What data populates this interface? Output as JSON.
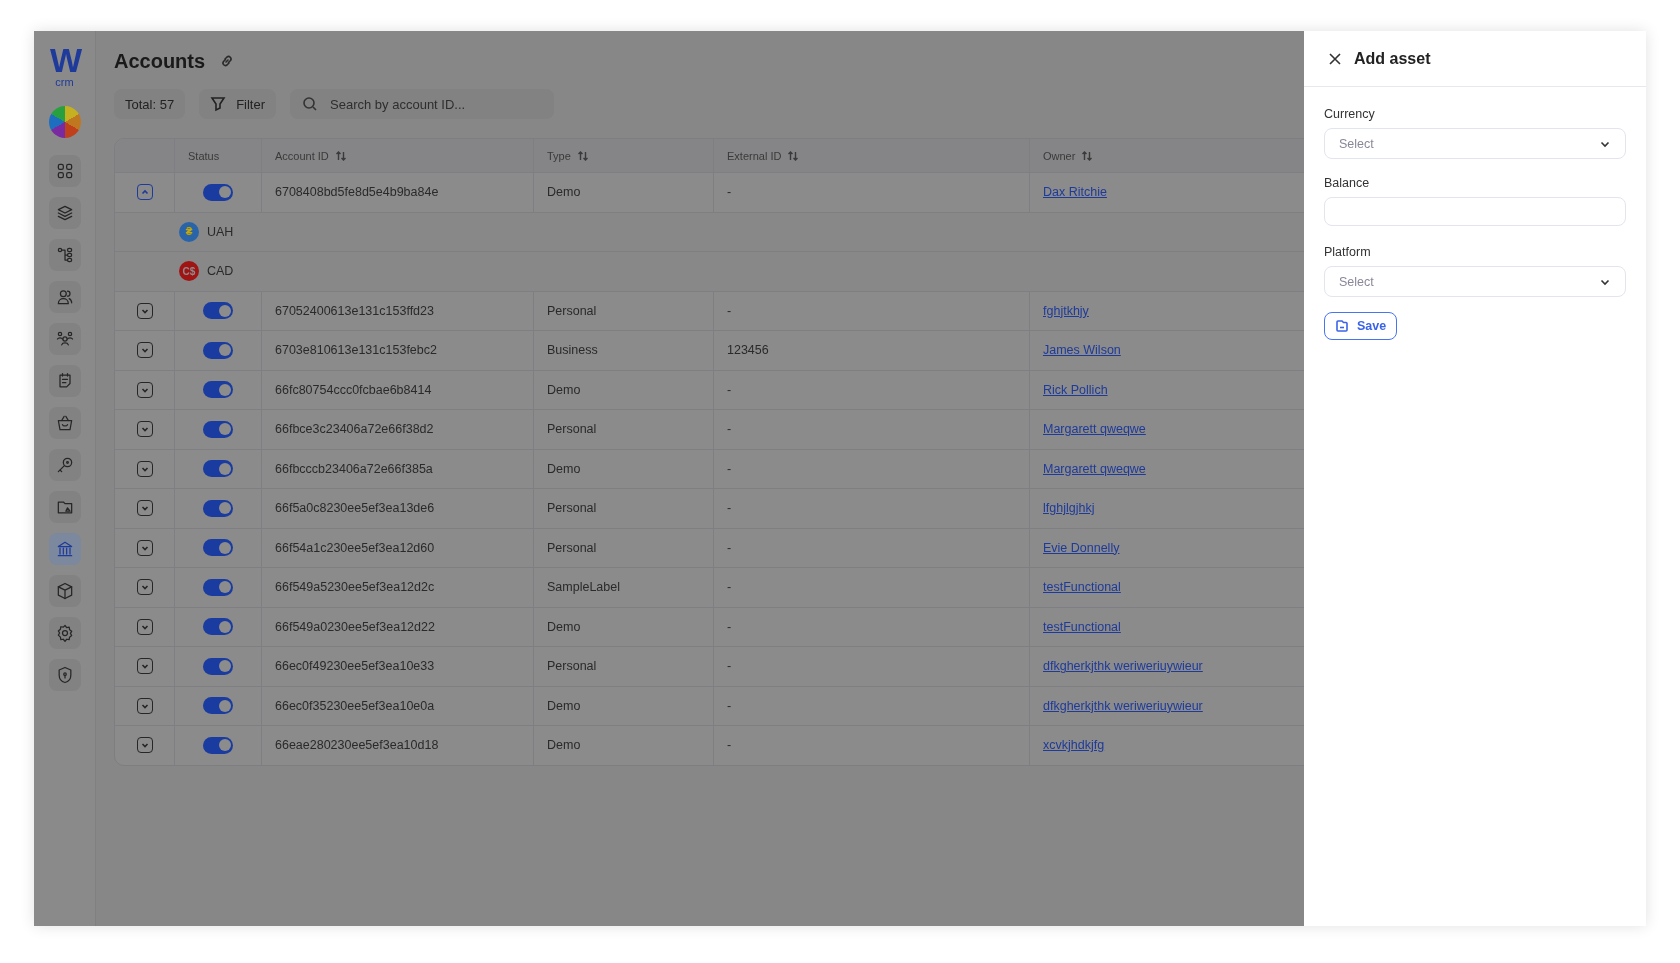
{
  "sidebar": {
    "logo": {
      "mark": "W",
      "caption": "crm"
    },
    "items": [
      {
        "selected": false
      },
      {
        "selected": false
      },
      {
        "selected": false
      },
      {
        "selected": false
      },
      {
        "selected": false
      },
      {
        "selected": false
      },
      {
        "selected": false
      },
      {
        "selected": false
      },
      {
        "selected": false
      },
      {
        "selected": true
      },
      {
        "selected": false
      },
      {
        "selected": false
      },
      {
        "selected": false
      }
    ]
  },
  "page": {
    "title": "Accounts",
    "total": "Total: 57",
    "filter": "Filter",
    "search": {
      "placeholder": "Search by account ID..."
    }
  },
  "table": {
    "columns": [
      {
        "label": "Status",
        "sortable": false
      },
      {
        "label": "Account ID",
        "sortable": true
      },
      {
        "label": "Type",
        "sortable": true
      },
      {
        "label": "External ID",
        "sortable": true
      },
      {
        "label": "Owner",
        "sortable": true
      }
    ],
    "rows": [
      {
        "expanded": true,
        "on": true,
        "account_id": "6708408bd5fe8d5e4b9ba84e",
        "type": "Demo",
        "external_id": "-",
        "owner": "Dax Ritchie",
        "children": [
          {
            "symbol": "₴",
            "currency": "UAH",
            "color": "#2a64a8"
          },
          {
            "symbol": "C$",
            "currency": "CAD",
            "color": "#a01414"
          }
        ]
      },
      {
        "expanded": false,
        "on": true,
        "account_id": "67052400613e131c153ffd23",
        "type": "Personal",
        "external_id": "-",
        "owner": "fghjtkhjy"
      },
      {
        "expanded": false,
        "on": true,
        "account_id": "6703e810613e131c153febc2",
        "type": "Business",
        "external_id": "123456",
        "owner": "James Wilson"
      },
      {
        "expanded": false,
        "on": true,
        "account_id": "66fc80754ccc0fcbae6b8414",
        "type": "Demo",
        "external_id": "-",
        "owner": "Rick Pollich"
      },
      {
        "expanded": false,
        "on": true,
        "account_id": "66fbce3c23406a72e66f38d2",
        "type": "Personal",
        "external_id": "-",
        "owner": "Margarett qweqwe"
      },
      {
        "expanded": false,
        "on": true,
        "account_id": "66fbcccb23406a72e66f385a",
        "type": "Demo",
        "external_id": "-",
        "owner": "Margarett qweqwe"
      },
      {
        "expanded": false,
        "on": true,
        "account_id": "66f5a0c8230ee5ef3ea13de6",
        "type": "Personal",
        "external_id": "-",
        "owner": "lfghjlgjhkj"
      },
      {
        "expanded": false,
        "on": true,
        "account_id": "66f54a1c230ee5ef3ea12d60",
        "type": "Personal",
        "external_id": "-",
        "owner": "Evie Donnelly"
      },
      {
        "expanded": false,
        "on": true,
        "account_id": "66f549a5230ee5ef3ea12d2c",
        "type": "SampleLabel",
        "external_id": "-",
        "owner": "testFunctional"
      },
      {
        "expanded": false,
        "on": true,
        "account_id": "66f549a0230ee5ef3ea12d22",
        "type": "Demo",
        "external_id": "-",
        "owner": "testFunctional"
      },
      {
        "expanded": false,
        "on": true,
        "account_id": "66ec0f49230ee5ef3ea10e33",
        "type": "Personal",
        "external_id": "-",
        "owner": "dfkgherkjthk weriweriuywieur"
      },
      {
        "expanded": false,
        "on": true,
        "account_id": "66ec0f35230ee5ef3ea10e0a",
        "type": "Demo",
        "external_id": "-",
        "owner": "dfkgherkjthk weriweriuywieur"
      },
      {
        "expanded": false,
        "on": true,
        "account_id": "66eae280230ee5ef3ea10d18",
        "type": "Demo",
        "external_id": "-",
        "owner": "xcvkjhdkjfg"
      }
    ]
  },
  "panel": {
    "title": "Add asset",
    "fields": [
      {
        "kind": "select",
        "label": "Currency",
        "placeholder": "Select"
      },
      {
        "kind": "input",
        "label": "Balance"
      },
      {
        "kind": "select",
        "label": "Platform",
        "placeholder": "Select"
      }
    ],
    "save": "Save"
  }
}
